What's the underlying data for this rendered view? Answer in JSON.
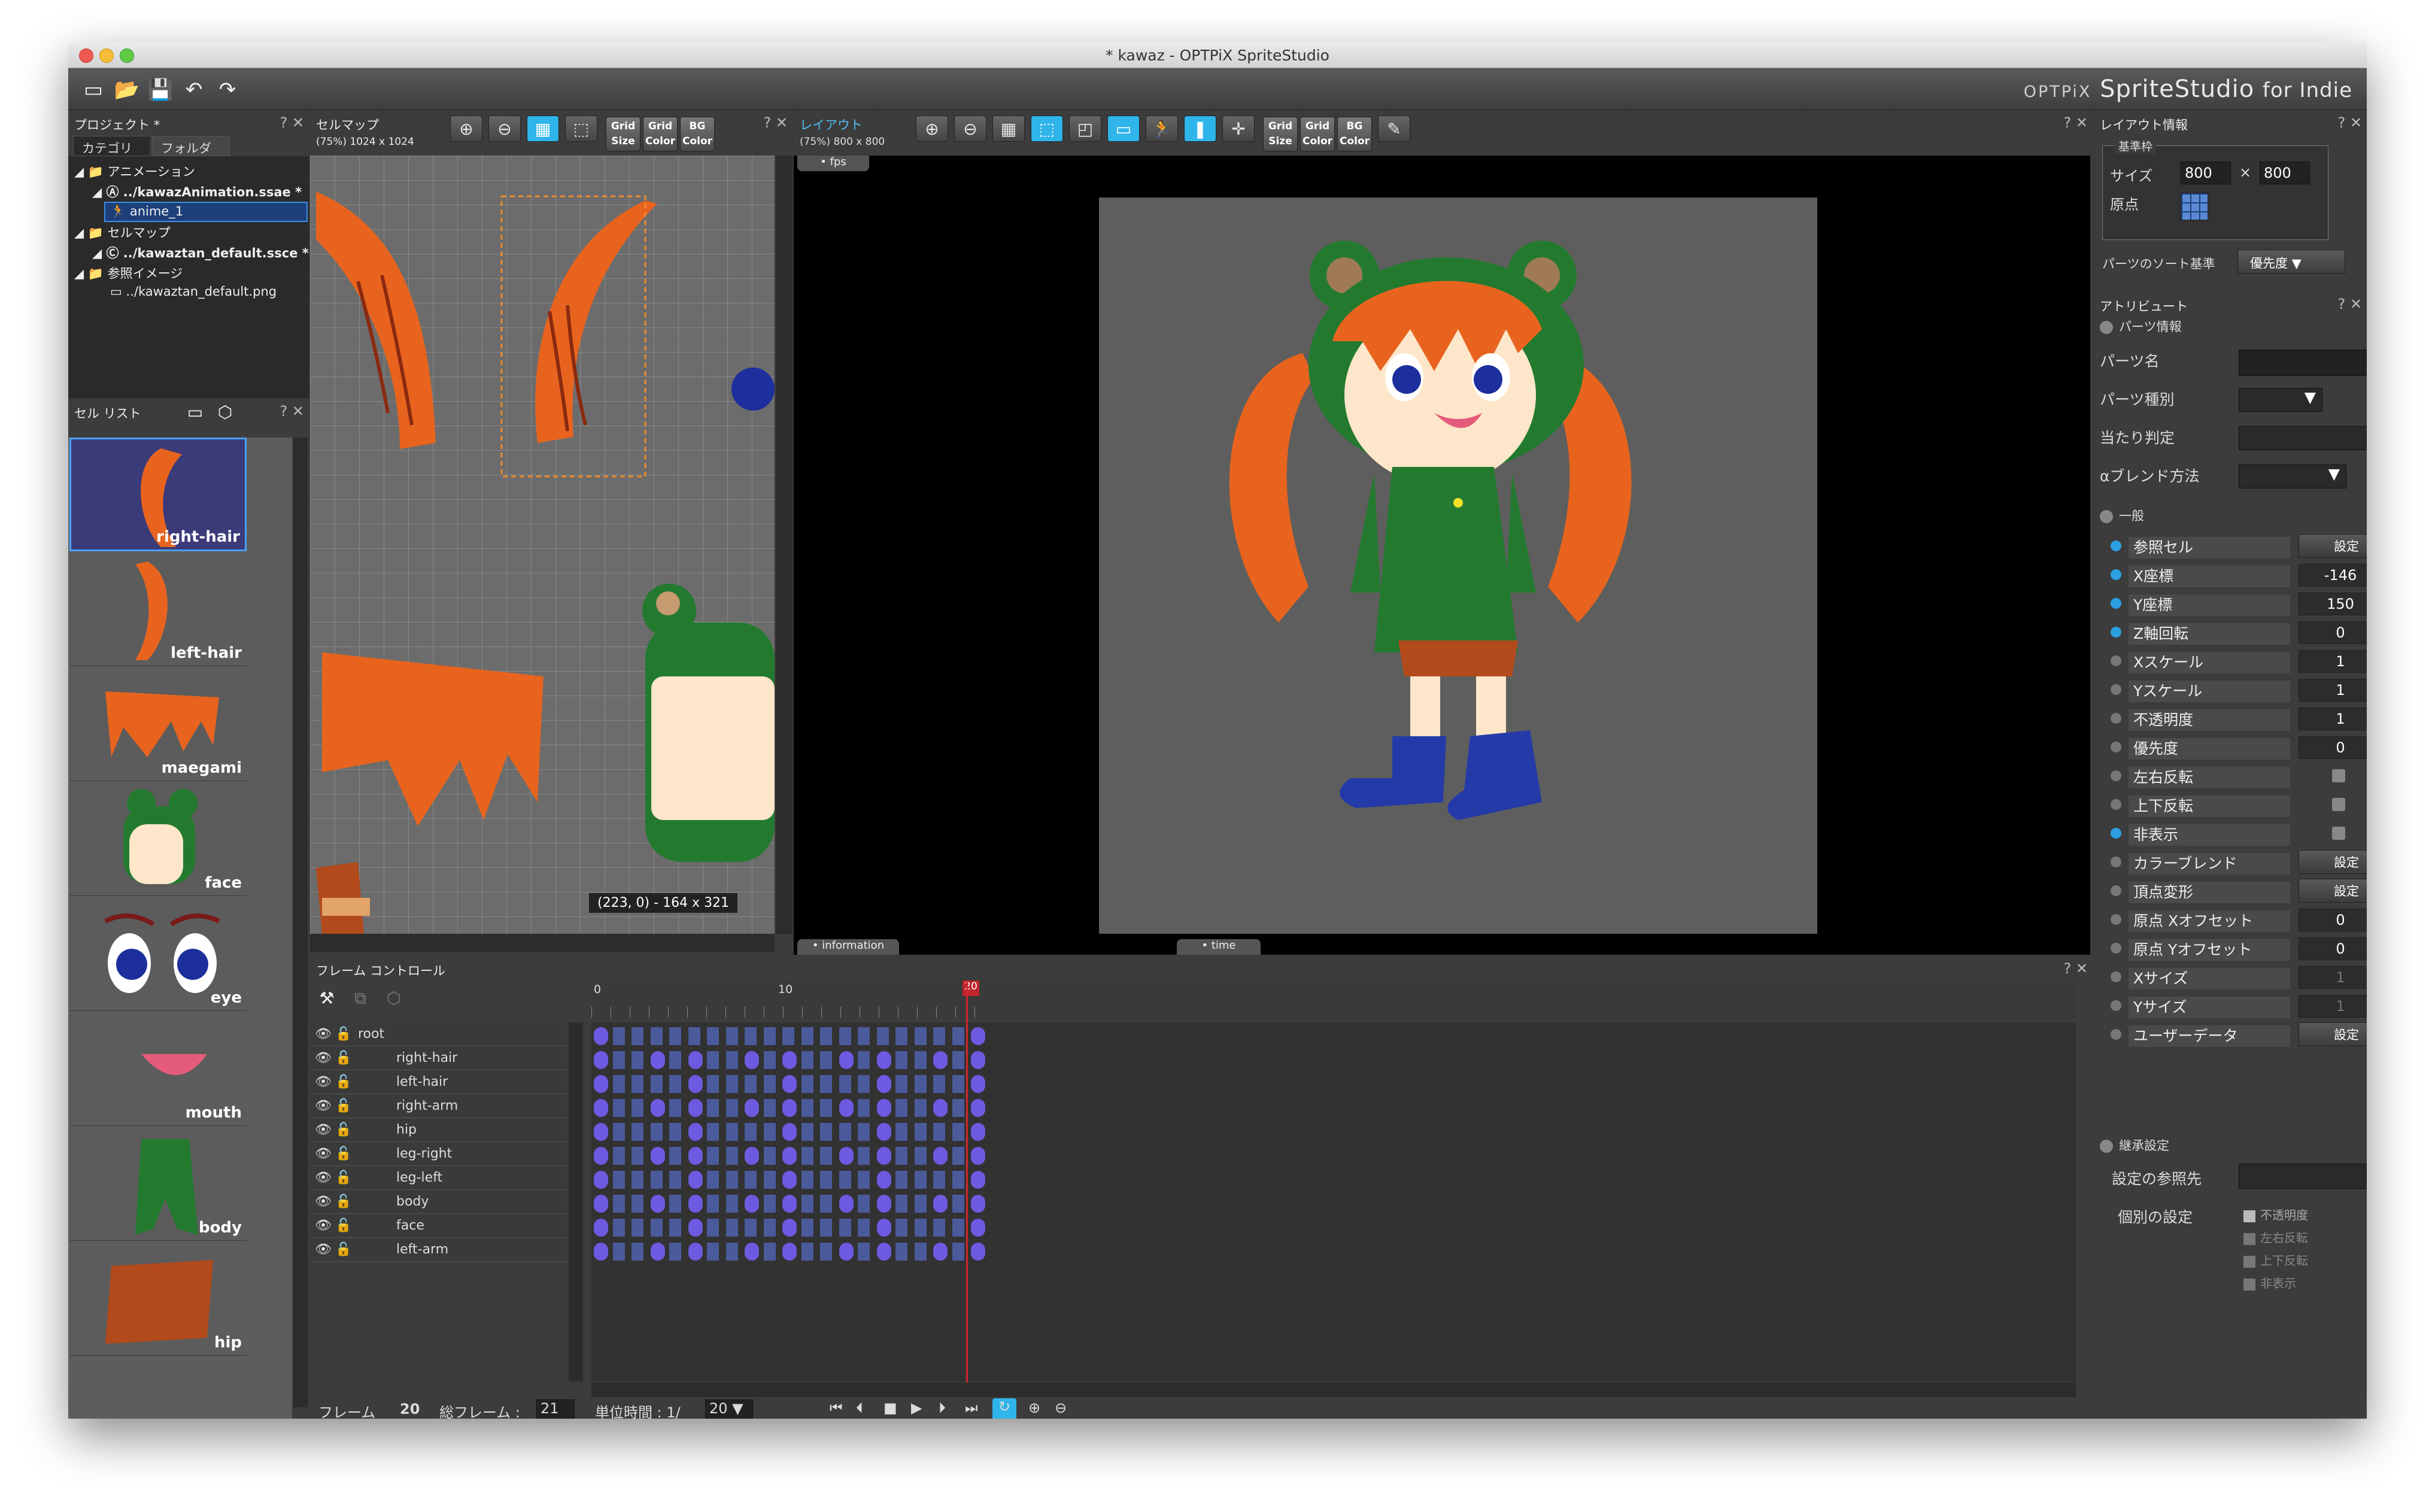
{
  "window": {
    "title": "* kawaz - OPTPiX SpriteStudio"
  },
  "brand": {
    "prefix": "OPTPiX",
    "name": "SpriteStudio",
    "suffix": "for Indie"
  },
  "project": {
    "title": "プロジェクト *",
    "tabs": [
      "カテゴリ",
      "フォルダ"
    ],
    "tree": [
      "アニメーション",
      "../kawazAnimation.ssae *",
      "anime_1",
      "セルマップ",
      "../kawaztan_default.ssce *",
      "参照イメージ",
      "../kawaztan_default.png"
    ]
  },
  "celllist": {
    "title": "セル リスト",
    "cells": [
      "right-hair",
      "left-hair",
      "maegami",
      "face",
      "eye",
      "mouth",
      "body",
      "hip"
    ]
  },
  "cellmap": {
    "title": "セルマップ",
    "info": "(75%) 1024 x 1024",
    "coords": "(223, 0) - 164 x 321",
    "grid": [
      "Grid",
      "Size",
      "Grid",
      "Color",
      "BG",
      "Color"
    ]
  },
  "layout": {
    "title": "レイアウト",
    "info": "(75%) 800 x 800",
    "fps": "• fps",
    "information": "• information",
    "time": "• time",
    "grid": [
      "Grid",
      "Size",
      "Grid",
      "Color",
      "BG",
      "Color"
    ]
  },
  "layoutinfo": {
    "title": "レイアウト情報",
    "group": "基準枠",
    "size_label": "サイズ",
    "w": "800",
    "x": "×",
    "h": "800",
    "origin_label": "原点",
    "sort_label": "パーツのソート基準",
    "sort_value": "優先度"
  },
  "attributes": {
    "title": "アトリビュート",
    "parts_header": "パーツ情報",
    "parts": [
      "パーツ名",
      "パーツ種別",
      "当たり判定",
      "αブレンド方法"
    ],
    "general_header": "一般",
    "rows": [
      {
        "name": "参照セル",
        "kind": "set",
        "value": "設定",
        "on": true
      },
      {
        "name": "X座標",
        "kind": "num",
        "value": "-146",
        "on": true
      },
      {
        "name": "Y座標",
        "kind": "num",
        "value": "150",
        "on": true
      },
      {
        "name": "Z軸回転",
        "kind": "num",
        "value": "0",
        "on": true
      },
      {
        "name": "Xスケール",
        "kind": "num",
        "value": "1",
        "on": false
      },
      {
        "name": "Yスケール",
        "kind": "num",
        "value": "1",
        "on": false
      },
      {
        "name": "不透明度",
        "kind": "num",
        "value": "1",
        "on": false
      },
      {
        "name": "優先度",
        "kind": "num",
        "value": "0",
        "on": false
      },
      {
        "name": "左右反転",
        "kind": "chk",
        "value": "",
        "on": false
      },
      {
        "name": "上下反転",
        "kind": "chk",
        "value": "",
        "on": false
      },
      {
        "name": "非表示",
        "kind": "chk",
        "value": "",
        "on": true
      },
      {
        "name": "カラーブレンド",
        "kind": "set",
        "value": "設定",
        "on": false
      },
      {
        "name": "頂点変形",
        "kind": "set",
        "value": "設定",
        "on": false
      },
      {
        "name": "原点 Xオフセット",
        "kind": "num",
        "value": "0",
        "on": false
      },
      {
        "name": "原点 Yオフセット",
        "kind": "num",
        "value": "0",
        "on": false
      },
      {
        "name": "Xサイズ",
        "kind": "num",
        "value": "1",
        "on": false
      },
      {
        "name": "Yサイズ",
        "kind": "num",
        "value": "1",
        "on": false
      },
      {
        "name": "ユーザーデータ",
        "kind": "set",
        "value": "設定",
        "on": false
      }
    ],
    "inherit_header": "継承設定",
    "inherit_ref": "設定の参照先",
    "inherit_each": "個別の設定",
    "inherit_items": [
      "不透明度",
      "左右反転",
      "上下反転",
      "非表示"
    ]
  },
  "frames": {
    "title": "フレーム コントロール",
    "ruler": [
      "0",
      "10",
      "20"
    ],
    "tracks": [
      "root",
      "right-hair",
      "left-hair",
      "right-arm",
      "hip",
      "leg-right",
      "leg-left",
      "body",
      "face",
      "left-arm"
    ],
    "frame_label": "フレーム",
    "frame_value": "20",
    "total_label": "総フレーム :",
    "total_value": "21",
    "unit_label": "単位時間 : 1/",
    "unit_value": "20"
  }
}
